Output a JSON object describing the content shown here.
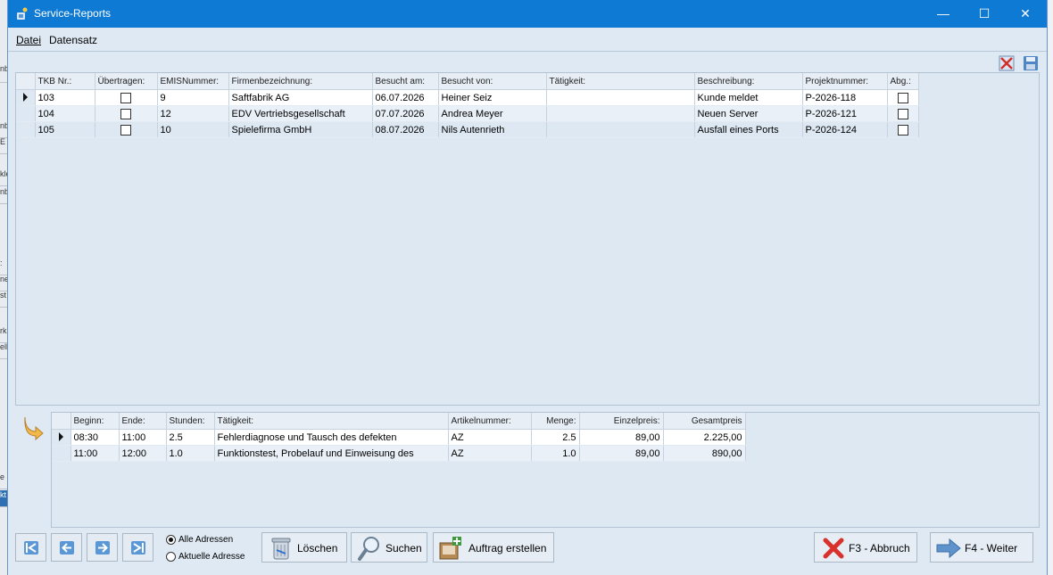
{
  "window": {
    "title": "Service-Reports",
    "minimize": "—",
    "maximize": "☐",
    "close": "✕"
  },
  "menu": {
    "datei": "Datei",
    "datensatz": "Datensatz"
  },
  "reports": {
    "headers": [
      "TKB Nr.:",
      "Übertragen:",
      "EMISNummer:",
      "Firmenbezeichnung:",
      "Besucht am:",
      "Besucht von:",
      "Tätigkeit:",
      "Beschreibung:",
      "Projektnummer:",
      "Abg.:"
    ],
    "rows": [
      {
        "tkb": "103",
        "emis": "9",
        "firma": "Saftfabrik AG",
        "datum": "06.07.2026",
        "von": "Heiner Seiz",
        "taetigkeit": "",
        "beschreibung": "Kunde meldet",
        "projekt": "P-2026-118"
      },
      {
        "tkb": "104",
        "emis": "12",
        "firma": "EDV Vertriebsgesellschaft",
        "datum": "07.07.2026",
        "von": "Andrea Meyer",
        "taetigkeit": "",
        "beschreibung": "Neuen Server",
        "projekt": "P-2026-121"
      },
      {
        "tkb": "105",
        "emis": "10",
        "firma": "Spielefirma GmbH",
        "datum": "08.07.2026",
        "von": "Nils Autenrieth",
        "taetigkeit": "",
        "beschreibung": "Ausfall eines Ports",
        "projekt": "P-2026-124"
      }
    ]
  },
  "positions": {
    "headers": [
      "Beginn:",
      "Ende:",
      "Stunden:",
      "Tätigkeit:",
      "Artikelnummer:",
      "Menge:",
      "Einzelpreis:",
      "Gesamtpreis"
    ],
    "rows": [
      {
        "beginn": "08:30",
        "ende": "11:00",
        "stunden": "2.5",
        "taetigkeit": "Fehlerdiagnose und Tausch des defekten",
        "artikel": "AZ",
        "menge": "2.5",
        "einzel": "89,00",
        "gesamt": "2.225,00"
      },
      {
        "beginn": "11:00",
        "ende": "12:00",
        "stunden": "1.0",
        "taetigkeit": "Funktionstest, Probelauf und Einweisung des",
        "artikel": "AZ",
        "menge": "1.0",
        "einzel": "89,00",
        "gesamt": "890,00"
      }
    ]
  },
  "filter": {
    "alle": "Alle Adressen",
    "aktuelle": "Aktuelle Adresse"
  },
  "buttons": {
    "loeschen": "Löschen",
    "suchen": "Suchen",
    "auftrag": "Auftrag erstellen",
    "abbruch": "F3 - Abbruch",
    "weiter": "F4 - Weiter"
  },
  "background_strip": [
    "nb",
    "E",
    "kle",
    "nb",
    ":",
    "ne",
    "st",
    "rk",
    "ell",
    "e",
    "kt"
  ]
}
